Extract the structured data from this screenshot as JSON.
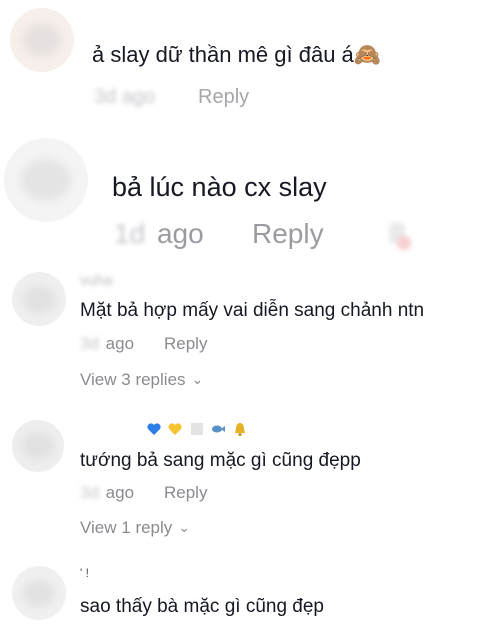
{
  "comments": [
    {
      "text": "ả slay dữ thần mê gì đâu á🙈",
      "time_blurred": "3d",
      "time_suffix": "ago",
      "reply_label": "Reply"
    },
    {
      "text": "bả lúc nào cx slay",
      "time_blurred": "1d",
      "time_suffix": "ago",
      "reply_label": "Reply"
    },
    {
      "username": "vuha",
      "text": "Mặt bả hợp mấy vai diễn sang chảnh ntn",
      "time_blurred": "3d",
      "time_suffix": "ago",
      "reply_label": "Reply",
      "view_replies": "View 3 replies"
    },
    {
      "username_emojis": [
        "blue-heart",
        "yellow-heart",
        "white-square",
        "fish",
        "bell"
      ],
      "text": "tướng bả sang mặc gì cũng đẹpp",
      "time_blurred": "3d",
      "time_suffix": "ago",
      "reply_label": "Reply",
      "view_replies": "View 1 reply"
    },
    {
      "username": "' !",
      "text": "sao thấy bà mặc gì cũng đẹp"
    }
  ],
  "icons": {
    "chevron": "chevron-down-icon",
    "heart": "like-heart-icon"
  },
  "colors": {
    "text": "#161823",
    "meta": "#8a8b91",
    "background": "#ffffff"
  }
}
